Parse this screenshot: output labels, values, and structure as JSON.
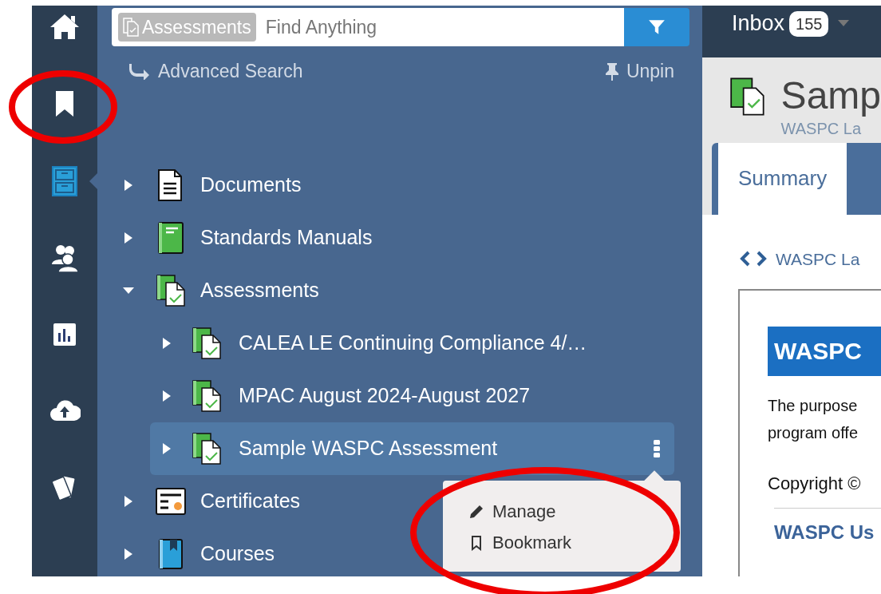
{
  "rail": [
    {
      "kind": "home",
      "selected": false
    },
    {
      "kind": "bookmark",
      "selected": false
    },
    {
      "kind": "cabinet",
      "selected": true
    },
    {
      "kind": "people",
      "selected": false
    },
    {
      "kind": "chart",
      "selected": false
    },
    {
      "kind": "upload",
      "selected": false
    },
    {
      "kind": "cards",
      "selected": false
    }
  ],
  "search": {
    "scope": "Assessments",
    "placeholder": "Find Anything"
  },
  "advanced_search": "Advanced Search",
  "unpin": "Unpin",
  "tree": [
    {
      "label": "Documents",
      "kind": "document",
      "expanded": false,
      "selected": false
    },
    {
      "label": "Standards Manuals",
      "kind": "manual",
      "expanded": false,
      "selected": false
    },
    {
      "label": "Assessments",
      "kind": "assessment",
      "expanded": true,
      "selected": false,
      "children": [
        {
          "label": "CALEA LE Continuing Compliance 4/…",
          "kind": "assessment",
          "expanded": false,
          "selected": false
        },
        {
          "label": "MPAC August 2024-August 2027",
          "kind": "assessment",
          "expanded": false,
          "selected": false
        },
        {
          "label": "Sample WASPC Assessment",
          "kind": "assessment",
          "expanded": false,
          "selected": true
        }
      ]
    },
    {
      "label": "Certificates",
      "kind": "certificate",
      "expanded": false,
      "selected": false
    },
    {
      "label": "Courses",
      "kind": "course",
      "expanded": false,
      "selected": false
    }
  ],
  "context_menu": [
    {
      "label": "Manage",
      "kind": "edit"
    },
    {
      "label": "Bookmark",
      "kind": "bookmark"
    }
  ],
  "inbox": {
    "label": "Inbox",
    "count": "155"
  },
  "record": {
    "title": "Samp",
    "subtitle": "WASPC La"
  },
  "tabs": [
    {
      "label": "Summary",
      "selected": true
    },
    {
      "selected": false
    }
  ],
  "breadcrumb": "WASPC La",
  "content": {
    "heading": "WASPC",
    "lines": [
      "The purpose",
      "program offe"
    ],
    "copyright": "Copyright ©",
    "link": "WASPC Us"
  },
  "annotations": [
    {
      "kind": "ellipse"
    },
    {
      "kind": "ellipse"
    }
  ]
}
